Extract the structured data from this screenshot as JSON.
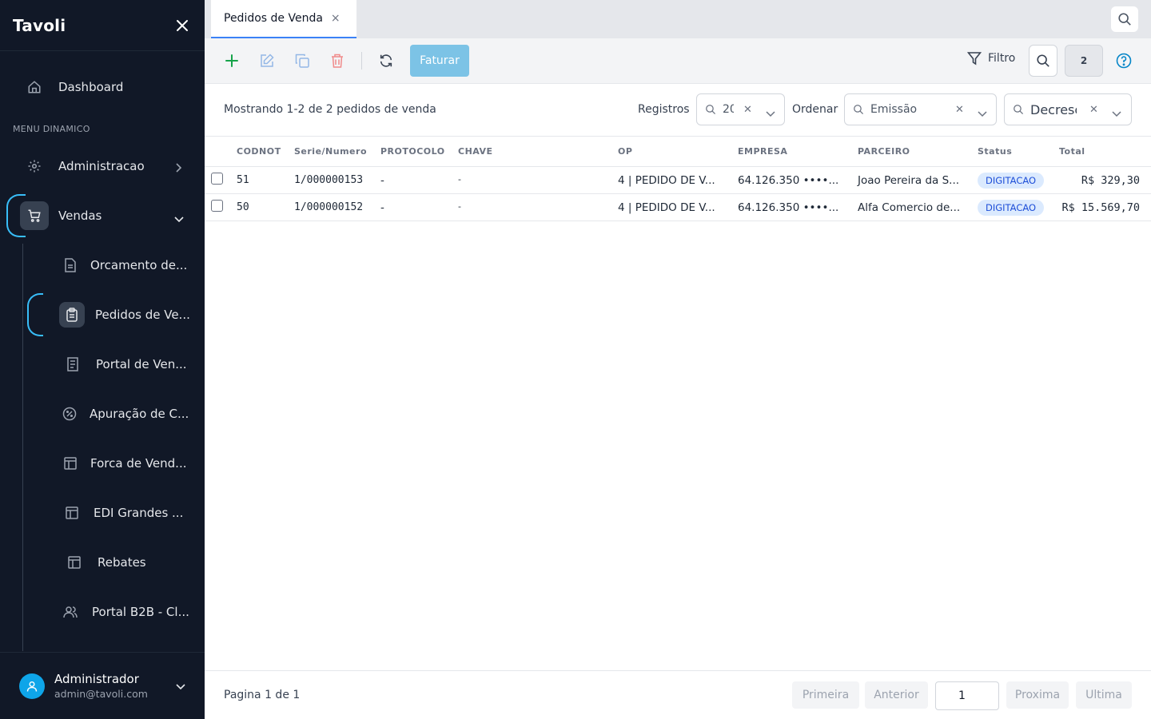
{
  "app": {
    "brand": "Tavoli"
  },
  "sidebar": {
    "dashboard": "Dashboard",
    "section": "MENU DINAMICO",
    "administracao": "Administracao",
    "vendas": "Vendas",
    "subitems": [
      "Orcamento de...",
      "Pedidos de Ve...",
      "Portal de Ven...",
      "Apuração de C...",
      "Forca de Vend...",
      "EDI Grandes ...",
      "Rebates",
      "Portal B2B - Cl..."
    ],
    "user": {
      "name": "Administrador",
      "email": "admin@tavoli.com"
    }
  },
  "tabs": [
    {
      "label": "Pedidos de Venda",
      "close": "×"
    }
  ],
  "toolbar": {
    "faturar": "Faturar",
    "filtro": "Filtro",
    "count": "2"
  },
  "info": {
    "showing": "Mostrando 1-2 de 2 pedidos de venda",
    "registros_label": "Registros",
    "registros_value": "20",
    "ordenar_label": "Ordenar",
    "ordenar_value": "Emissão",
    "direction_value": "Decrescente"
  },
  "table": {
    "columns": [
      "CODNOT",
      "Serie/Numero",
      "PROTOCOLO",
      "CHAVE",
      "OP",
      "EMPRESA",
      "PARCEIRO",
      "Status",
      "Total"
    ],
    "rows": [
      {
        "codnot": "51",
        "serie": "1/000000153",
        "protocolo": "-",
        "chave": "-",
        "op": "4 | PEDIDO DE V...",
        "empresa": "64.126.350 ••••...",
        "parceiro": "Joao Pereira da S...",
        "status": "DIGITACAO",
        "total": "R$ 329,30"
      },
      {
        "codnot": "50",
        "serie": "1/000000152",
        "protocolo": "-",
        "chave": "-",
        "op": "4 | PEDIDO DE V...",
        "empresa": "64.126.350 ••••...",
        "parceiro": "Alfa Comercio de...",
        "status": "DIGITACAO",
        "total": "R$ 15.569,70"
      }
    ]
  },
  "pagination": {
    "text": "Pagina 1 de 1",
    "first": "Primeira",
    "prev": "Anterior",
    "page": "1",
    "next": "Proxima",
    "last": "Ultima"
  },
  "colors": {
    "sidebar_bg": "#111827",
    "accent": "#38bdf8",
    "faturar_bg": "#7cc3e6",
    "add_green": "#16a34a",
    "delete_red": "#ef4444"
  }
}
